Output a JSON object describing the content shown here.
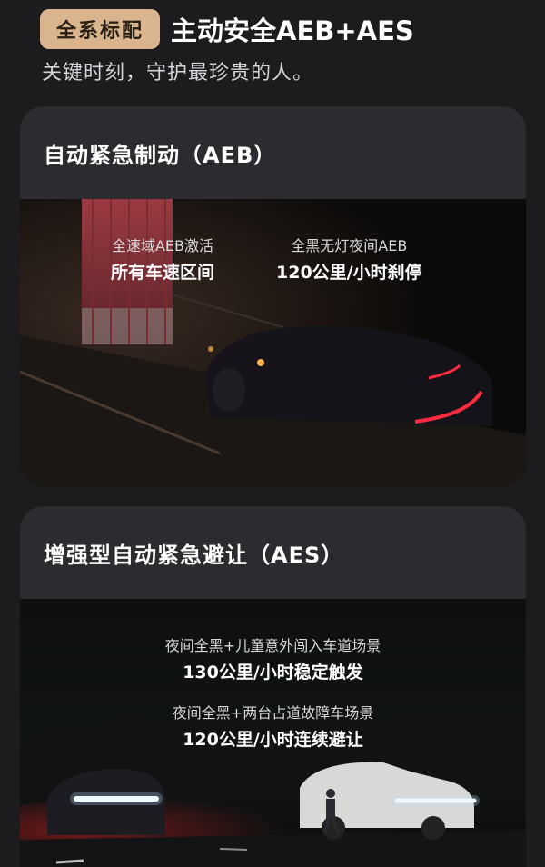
{
  "header": {
    "badge": "全系标配",
    "title": "主动安全AEB+AES",
    "subtitle": "关键时刻，守护最珍贵的人。"
  },
  "aeb": {
    "title": "自动紧急制动（AEB）",
    "stats": [
      {
        "label": "全速域AEB激活",
        "value": "所有车速区间"
      },
      {
        "label": "全黑无灯夜间AEB",
        "value": "120公里/小时刹停"
      }
    ]
  },
  "aes": {
    "title": "增强型自动紧急避让（AES）",
    "stats": [
      {
        "label": "夜间全黑+儿童意外闯入车道场景",
        "value": "130公里/小时稳定触发"
      },
      {
        "label": "夜间全黑+两台占道故障车场景",
        "value": "120公里/小时连续避让"
      }
    ]
  },
  "colors": {
    "background": "#1c1c1f",
    "card": "#2b2b30",
    "badge": "#d9b48c",
    "taillight": "#ff2a3d"
  }
}
